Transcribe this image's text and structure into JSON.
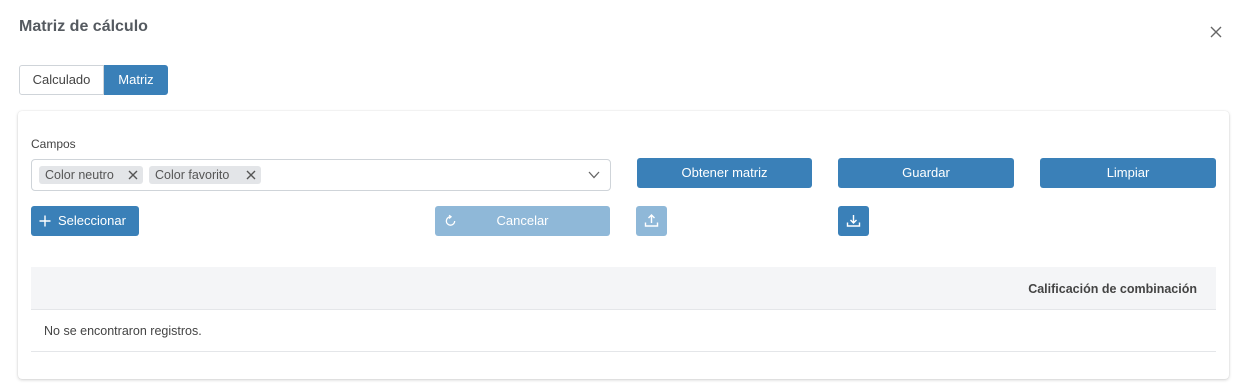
{
  "dialog": {
    "title": "Matriz de cálculo",
    "close_icon": "close-icon"
  },
  "tabs": [
    {
      "label": "Calculado",
      "active": false
    },
    {
      "label": "Matriz",
      "active": true
    }
  ],
  "form": {
    "campos_label": "Campos",
    "selected_fields": [
      "Color neutro",
      "Color favorito"
    ],
    "dropdown_icon": "chevron-down-icon"
  },
  "actions": {
    "obtener_matriz": "Obtener matriz",
    "guardar": "Guardar",
    "limpiar": "Limpiar",
    "seleccionar": "Seleccionar",
    "cancelar": "Cancelar",
    "upload_icon": "upload-icon",
    "download_icon": "download-icon"
  },
  "table": {
    "columns": [
      "Calificación de combinación"
    ],
    "empty_message": "No se encontraron registros."
  },
  "colors": {
    "primary": "#3a80b8",
    "primary_disabled": "#8fb8d8",
    "header_bg": "#f4f5f7",
    "chip_bg": "#e3e5e8"
  }
}
